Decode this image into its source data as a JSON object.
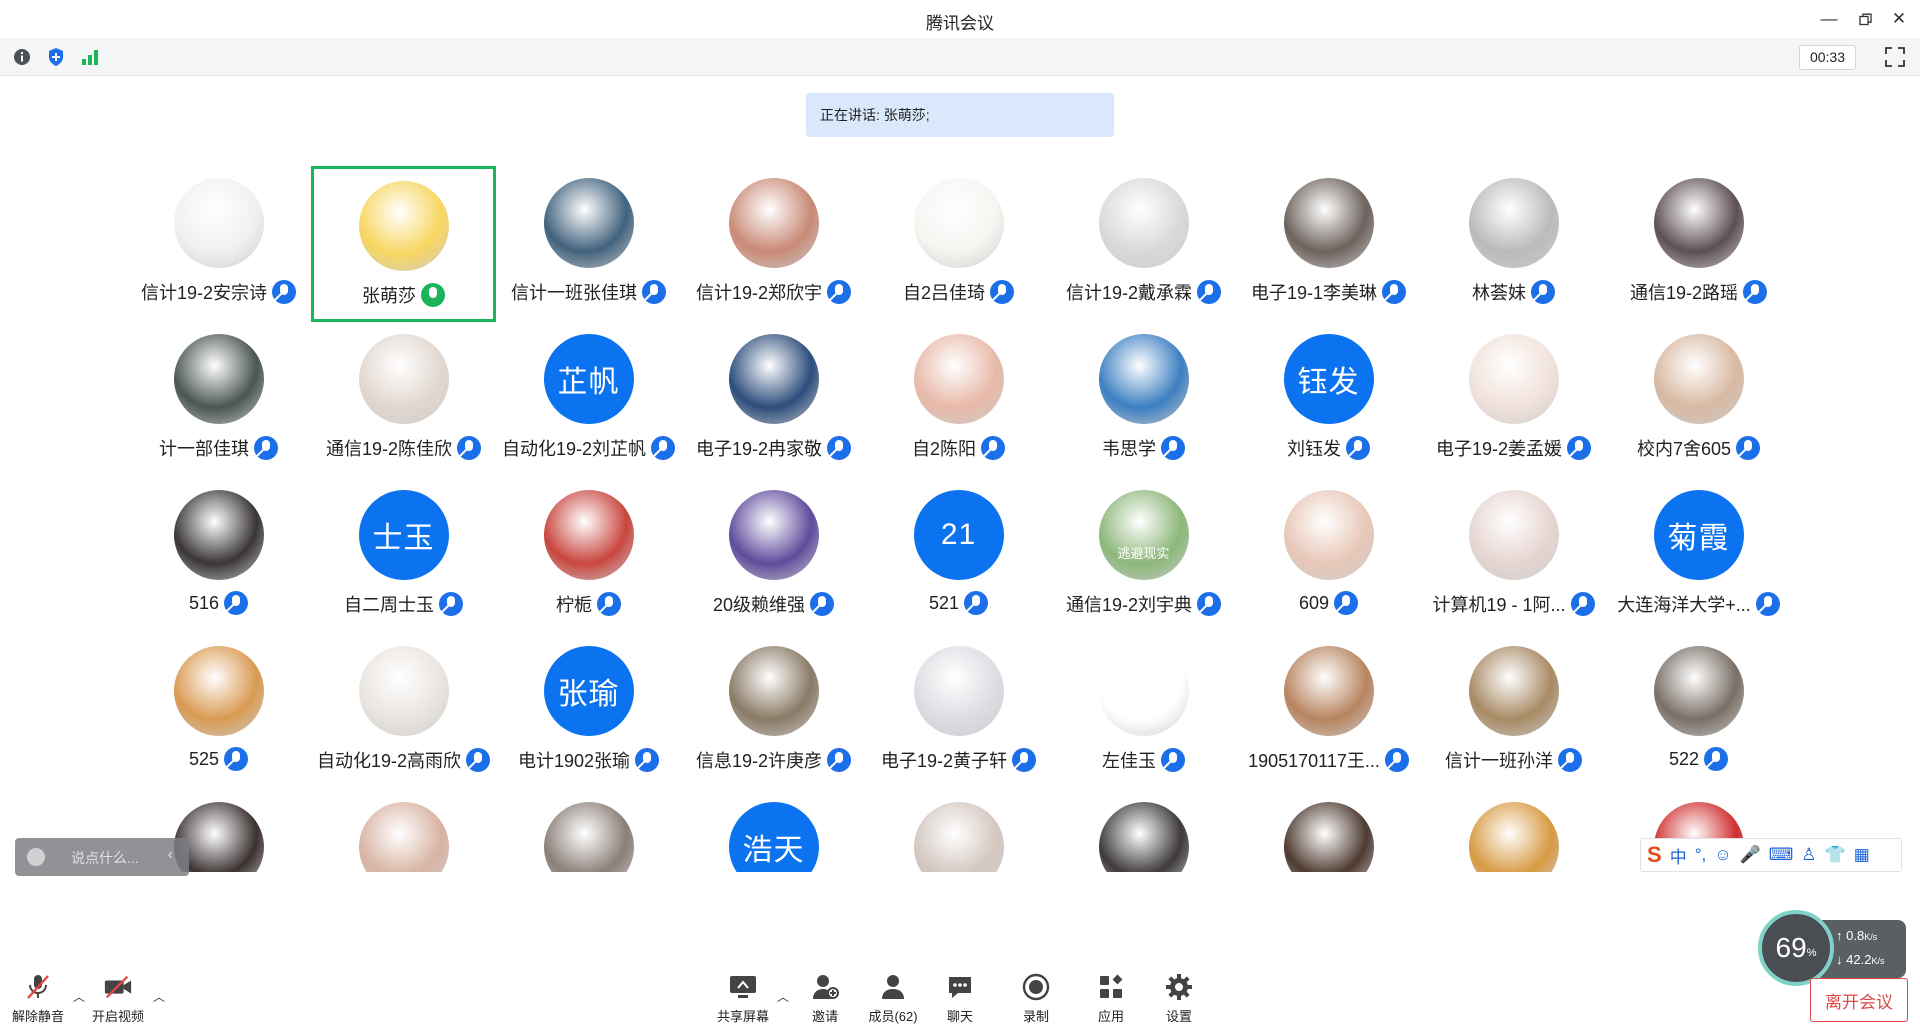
{
  "window": {
    "title": "腾讯会议"
  },
  "infobar": {
    "timer": "00:33"
  },
  "speaking": {
    "text": "正在讲话: 张萌莎;"
  },
  "participants": [
    {
      "name": "信计19-2安宗诗",
      "avatar": "photo",
      "color": "#f0f0f0",
      "initials": ""
    },
    {
      "name": "张萌莎",
      "avatar": "photo",
      "color": "#f7d660",
      "initials": "",
      "active": true
    },
    {
      "name": "信计一班张佳琪",
      "avatar": "photo",
      "color": "#41627d",
      "initials": ""
    },
    {
      "name": "信计19-2郑欣宇",
      "avatar": "photo",
      "color": "#c98a76",
      "initials": ""
    },
    {
      "name": "自2吕佳琦",
      "avatar": "photo",
      "color": "#f3f6f1",
      "initials": ""
    },
    {
      "name": "信计19-2戴承霖",
      "avatar": "photo",
      "color": "#d8d9db",
      "initials": ""
    },
    {
      "name": "电子19-1李美琳",
      "avatar": "photo",
      "color": "#6d625c",
      "initials": ""
    },
    {
      "name": "林荟妹",
      "avatar": "photo",
      "color": "#b9bcbb",
      "initials": ""
    },
    {
      "name": "通信19-2路瑶",
      "avatar": "photo",
      "color": "#5e5052",
      "initials": ""
    },
    {
      "name": "计一部佳琪",
      "avatar": "photo",
      "color": "#4a5650",
      "initials": ""
    },
    {
      "name": "通信19-2陈佳欣",
      "avatar": "photo",
      "color": "#e2d7cf",
      "initials": ""
    },
    {
      "name": "自动化19-2刘芷帆",
      "avatar": "text",
      "color": "#0b73f0",
      "initials": "芷帆"
    },
    {
      "name": "电子19-2冉家敬",
      "avatar": "photo",
      "color": "#2c4d7c",
      "initials": ""
    },
    {
      "name": "自2陈阳",
      "avatar": "photo",
      "color": "#e8b9a8",
      "initials": ""
    },
    {
      "name": "韦思学",
      "avatar": "photo",
      "color": "#3c7fc1",
      "initials": ""
    },
    {
      "name": "刘钰发",
      "avatar": "text",
      "color": "#0b73f0",
      "initials": "钰发"
    },
    {
      "name": "电子19-2姜孟媛",
      "avatar": "photo",
      "color": "#f1e2da",
      "initials": ""
    },
    {
      "name": "校内7舍605",
      "avatar": "photo",
      "color": "#d8b9a2",
      "initials": ""
    },
    {
      "name": "516",
      "avatar": "photo",
      "color": "#3a3636",
      "initials": ""
    },
    {
      "name": "自二周士玉",
      "avatar": "text",
      "color": "#0b73f0",
      "initials": "士玉"
    },
    {
      "name": "柠栀",
      "avatar": "photo",
      "color": "#c9463f",
      "initials": ""
    },
    {
      "name": "20级赖维强",
      "avatar": "photo",
      "color": "#5f4c9c",
      "initials": ""
    },
    {
      "name": "521",
      "avatar": "text",
      "color": "#0b73f0",
      "initials": "21"
    },
    {
      "name": "通信19-2刘宇典",
      "avatar": "photo",
      "color": "#8cb77a",
      "initials": "逃避现实"
    },
    {
      "name": "609",
      "avatar": "photo",
      "color": "#e8c7b7",
      "initials": ""
    },
    {
      "name": "计算机19 - 1阿...",
      "avatar": "photo",
      "color": "#e6d5d1",
      "initials": ""
    },
    {
      "name": "大连海洋大学+...",
      "avatar": "text",
      "color": "#0b73f0",
      "initials": "菊霞"
    },
    {
      "name": "525",
      "avatar": "photo",
      "color": "#d99a52",
      "initials": ""
    },
    {
      "name": "自动化19-2高雨欣",
      "avatar": "photo",
      "color": "#e9e4df",
      "initials": ""
    },
    {
      "name": "电计1902张瑜",
      "avatar": "text",
      "color": "#0b73f0",
      "initials": "张瑜"
    },
    {
      "name": "信息19-2许庚彦",
      "avatar": "photo",
      "color": "#8a7a66",
      "initials": ""
    },
    {
      "name": "电子19-2黄子轩",
      "avatar": "photo",
      "color": "#dcdde2",
      "initials": ""
    },
    {
      "name": "左佳玉",
      "avatar": "photo",
      "color": "#ffffff",
      "initials": ""
    },
    {
      "name": "1905170117王...",
      "avatar": "photo",
      "color": "#b88460",
      "initials": ""
    },
    {
      "name": "信计一班孙洋",
      "avatar": "photo",
      "color": "#a88a64",
      "initials": ""
    },
    {
      "name": "522",
      "avatar": "photo",
      "color": "#7a6f66",
      "initials": ""
    },
    {
      "name": "",
      "avatar": "photo",
      "color": "#3b3131",
      "initials": ""
    },
    {
      "name": "",
      "avatar": "photo",
      "color": "#d8b3a2",
      "initials": ""
    },
    {
      "name": "",
      "avatar": "photo",
      "color": "#8b7f78",
      "initials": ""
    },
    {
      "name": "",
      "avatar": "text",
      "color": "#0b73f0",
      "initials": "浩天"
    },
    {
      "name": "",
      "avatar": "photo",
      "color": "#d4c7c0",
      "initials": ""
    },
    {
      "name": "",
      "avatar": "photo",
      "color": "#3d3a39",
      "initials": ""
    },
    {
      "name": "",
      "avatar": "photo",
      "color": "#4d3a30",
      "initials": ""
    },
    {
      "name": "",
      "avatar": "photo",
      "color": "#d79a42",
      "initials": ""
    },
    {
      "name": "",
      "avatar": "photo",
      "color": "#cf2f2f",
      "initials": ""
    }
  ],
  "chat": {
    "placeholder": "说点什么..."
  },
  "ime": {
    "logo": "S",
    "mode": "中"
  },
  "network": {
    "cpu": "69",
    "cpu_unit": "%",
    "up": "0.8",
    "down": "42.2",
    "rate_unit": "K/s"
  },
  "toolbar": {
    "unmute": "解除静音",
    "video": "开启视频",
    "share": "共享屏幕",
    "invite": "邀请",
    "members": "成员(62)",
    "chat": "聊天",
    "record": "录制",
    "apps": "应用",
    "settings": "设置",
    "leave": "离开会议"
  }
}
